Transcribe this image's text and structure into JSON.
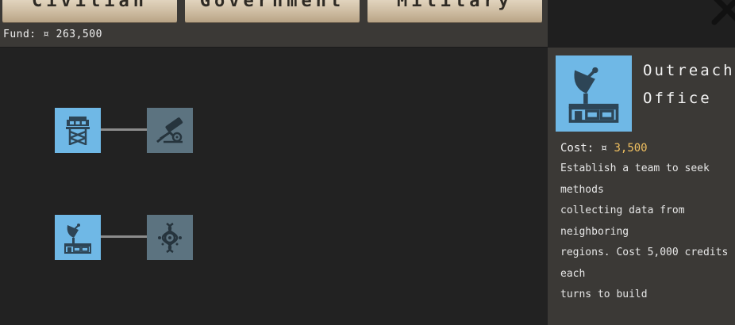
{
  "tabs": [
    {
      "label": "Civilian"
    },
    {
      "label": "Government"
    },
    {
      "label": "Military"
    }
  ],
  "fund": {
    "label": "Fund:",
    "currency_symbol": "¤",
    "amount": "263,500"
  },
  "close_icon": "close-icon",
  "tree": {
    "rows": [
      {
        "nodes": [
          {
            "icon": "watchtower-icon",
            "state": "unlocked"
          },
          {
            "icon": "surveillance-camera-icon",
            "state": "locked"
          }
        ]
      },
      {
        "nodes": [
          {
            "icon": "satellite-dish-building-icon",
            "state": "unlocked"
          },
          {
            "icon": "dna-gear-icon",
            "state": "locked"
          }
        ]
      }
    ]
  },
  "detail": {
    "icon": "satellite-dish-building-icon",
    "title": "Outreach Office",
    "cost_label": "Cost:",
    "currency_symbol": "¤",
    "cost_value": "3,500",
    "description": "Establish a team to seek methods\ncollecting data from neighboring\nregions. Cost 5,000 credits each\nturns to build"
  },
  "colors": {
    "unlocked": "#6fb8e6",
    "locked": "#5c7380",
    "accent_cost": "#f0c060",
    "panel_bg": "#3b3936",
    "tree_bg": "#222222"
  }
}
